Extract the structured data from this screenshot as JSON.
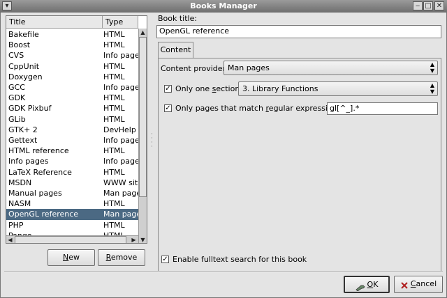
{
  "window": {
    "title": "Books Manager",
    "controls": [
      "▾",
      "‒",
      "□",
      "✕"
    ]
  },
  "list": {
    "columns": [
      "Title",
      "Type"
    ],
    "rows": [
      {
        "title": "Bakefile",
        "type": "HTML"
      },
      {
        "title": "Boost",
        "type": "HTML"
      },
      {
        "title": "CVS",
        "type": "Info pages"
      },
      {
        "title": "CppUnit",
        "type": "HTML"
      },
      {
        "title": "Doxygen",
        "type": "HTML"
      },
      {
        "title": "GCC",
        "type": "Info pages"
      },
      {
        "title": "GDK",
        "type": "HTML"
      },
      {
        "title": "GDK Pixbuf",
        "type": "HTML"
      },
      {
        "title": "GLib",
        "type": "HTML"
      },
      {
        "title": "GTK+ 2",
        "type": "DevHelp"
      },
      {
        "title": "Gettext",
        "type": "Info pages"
      },
      {
        "title": "HTML reference",
        "type": "HTML"
      },
      {
        "title": "Info pages",
        "type": "Info pages"
      },
      {
        "title": "LaTeX Reference",
        "type": "HTML"
      },
      {
        "title": "MSDN",
        "type": "WWW site"
      },
      {
        "title": "Manual pages",
        "type": "Man pages"
      },
      {
        "title": "NASM",
        "type": "HTML"
      },
      {
        "title": "OpenGL reference",
        "type": "Man pages"
      },
      {
        "title": "PHP",
        "type": "HTML"
      },
      {
        "title": "Pango",
        "type": "HTML"
      }
    ],
    "selected_title": "OpenGL reference"
  },
  "buttons": {
    "new_label": "New",
    "new_mnemonic": "N",
    "new_rest": "ew",
    "remove_label": "Remove",
    "remove_mnemonic": "R",
    "remove_rest": "emove",
    "ok_label": "OK",
    "ok_mnemonic": "O",
    "ok_rest": "K",
    "cancel_label": "Cancel",
    "cancel_mnemonic": "C",
    "cancel_rest": "ancel"
  },
  "editor": {
    "book_title_label": "Book title:",
    "book_title_value": "OpenGL reference",
    "tab_label": "Content",
    "content_provider_label": "Content provider:",
    "content_provider_value": "Man pages",
    "only_one_section_label_pre": "Only one ",
    "only_one_section_label_mn": "s",
    "only_one_section_label_post": "ection:",
    "only_one_section_checked": true,
    "section_value": "3. Library Functions",
    "regex_label_pre": "Only pages that match ",
    "regex_label_mn": "r",
    "regex_label_post": "egular expression:",
    "regex_checked": true,
    "regex_value": "gl[^_].*",
    "fulltext_label": "Enable fulltext search for this book",
    "fulltext_checked": true
  },
  "icons": {
    "check": "✓",
    "updown": "▲▼",
    "up": "▲",
    "down": "▼",
    "left": "◀",
    "right": "▶",
    "ok_icon": "wrench-icon",
    "cancel_icon": "cancel-x-icon"
  }
}
